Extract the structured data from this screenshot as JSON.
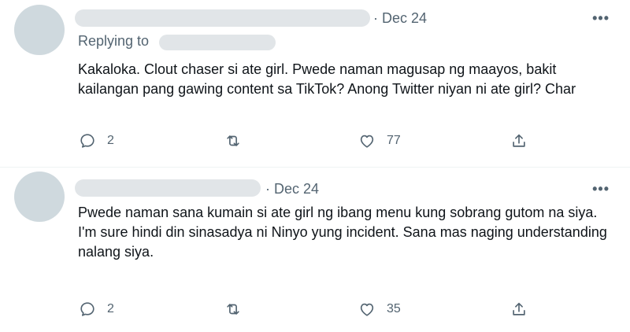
{
  "tweets": [
    {
      "date": "· Dec 24",
      "more": "•••",
      "replying_to": "Replying to",
      "body_lines": [
        "Kakaloka. Clout chaser si ate girl. Pwede naman magusap ng maayos, bakit kailangan pang gawing content sa TikTok? Anong Twitter niyan ni ate girl? Char"
      ],
      "replies": "2",
      "likes": "77"
    },
    {
      "date": "· Dec 24",
      "more": "•••",
      "body_lines": [
        "Pwede naman sana kumain si ate girl ng ibang menu kung sobrang gutom na siya.",
        " I'm sure hindi din sinasadya ni Ninyo yung incident. Sana mas naging understanding nalang siya."
      ],
      "replies": "2",
      "likes": "35"
    }
  ],
  "icons": {
    "reply": "reply-icon",
    "retweet": "retweet-icon",
    "like": "heart-icon",
    "share": "share-icon",
    "more": "more-icon"
  },
  "colors": {
    "text": "#0f1419",
    "secondary": "#536471",
    "redaction": "#e1e5e8",
    "avatar_placeholder": "#cfd9de"
  }
}
